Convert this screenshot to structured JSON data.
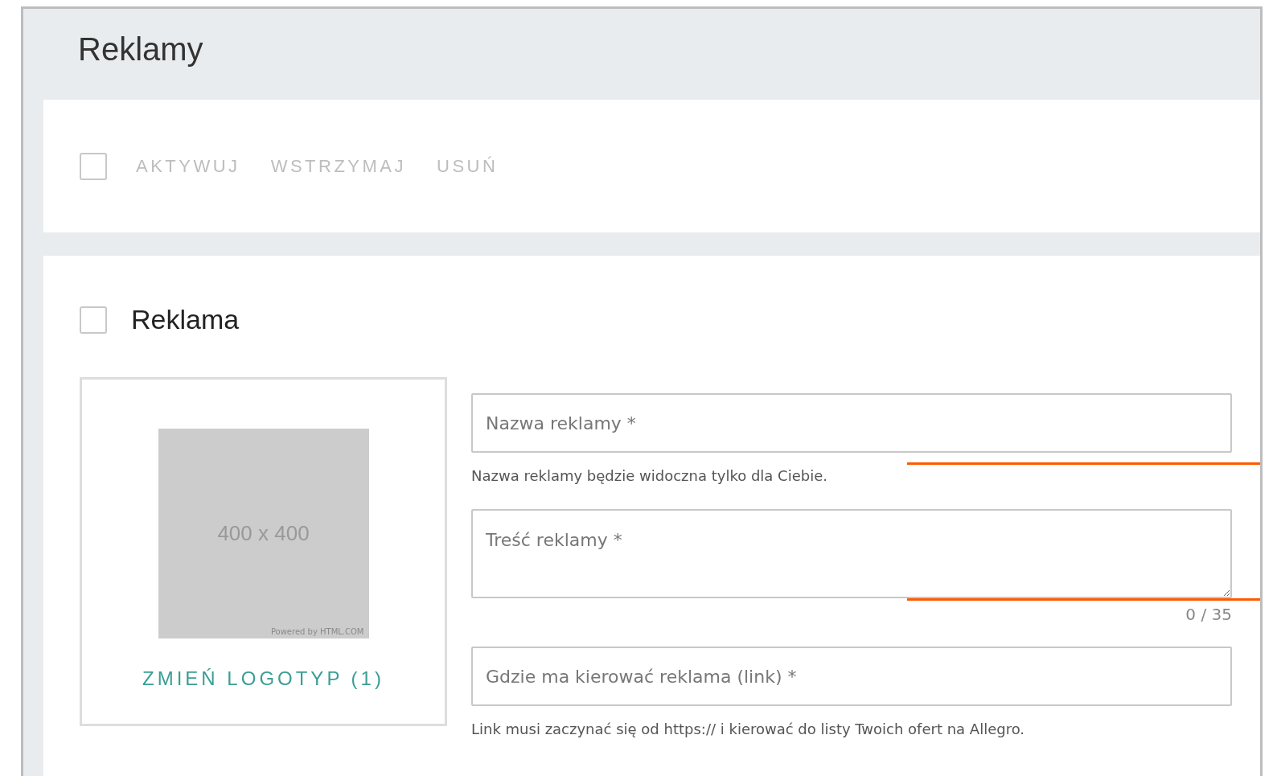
{
  "page": {
    "title": "Reklamy"
  },
  "toolbar": {
    "select_all": {
      "checked": false
    },
    "actions": [
      {
        "label": "AKTYWUJ",
        "disabled": true
      },
      {
        "label": "WSTRZYMAJ",
        "disabled": true
      },
      {
        "label": "USUŃ",
        "disabled": true
      }
    ]
  },
  "ad": {
    "title": "Reklama",
    "checked": false,
    "logo": {
      "placeholder_text": "400 x 400",
      "credit": "Powered by HTML.COM",
      "change_label": "ZMIEŃ LOGOTYP (1)"
    },
    "fields": [
      {
        "kind": "input",
        "placeholder": "Nazwa reklamy *",
        "help": "Nazwa reklamy będzie widoczna tylko dla Ciebie."
      },
      {
        "kind": "textarea",
        "placeholder": "Treść reklamy *",
        "counter": "0 / 35"
      },
      {
        "kind": "input",
        "placeholder": "Gdzie ma kierować reklama (link) *",
        "help": "Link musi zaczynać się od https:// i kierować do listy Twoich ofert na Allegro."
      }
    ]
  }
}
